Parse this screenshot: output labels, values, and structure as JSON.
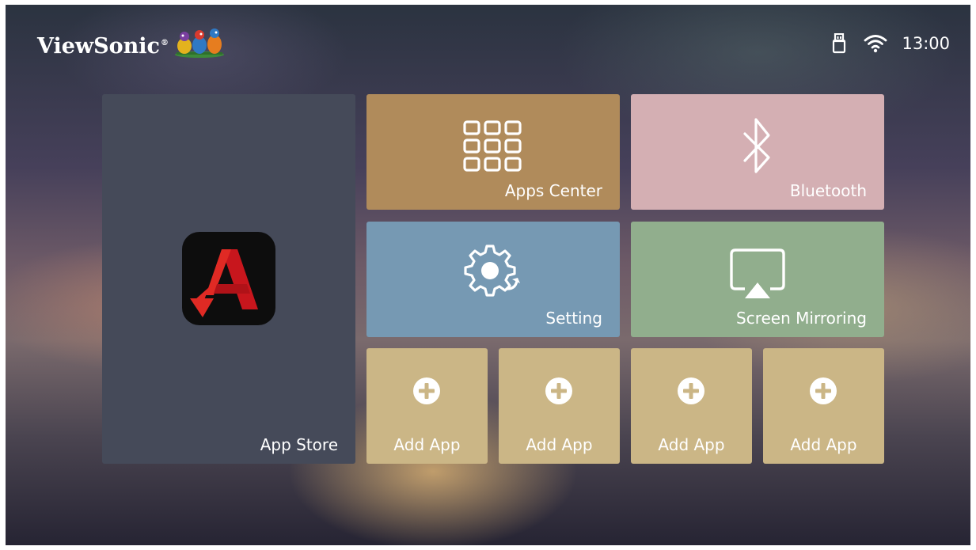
{
  "header": {
    "brand": "ViewSonic",
    "brand_mark": "®",
    "status": {
      "usb_icon": "usb-drive-icon",
      "wifi_icon": "wifi-icon",
      "time": "13:00"
    }
  },
  "tiles": {
    "app_store": {
      "label": "App Store",
      "icon": "aptoide-icon",
      "color": "#454a59"
    },
    "apps_center": {
      "label": "Apps Center",
      "icon": "grid-icon",
      "color": "#b08b5b"
    },
    "bluetooth": {
      "label": "Bluetooth",
      "icon": "bluetooth-icon",
      "color": "#d4afb3"
    },
    "setting": {
      "label": "Setting",
      "icon": "gear-icon",
      "color": "#7699b3"
    },
    "screen_mirroring": {
      "label": "Screen Mirroring",
      "icon": "airplay-icon",
      "color": "#91ae8d"
    },
    "add_apps": [
      {
        "label": "Add App",
        "icon": "plus-circle-icon"
      },
      {
        "label": "Add App",
        "icon": "plus-circle-icon"
      },
      {
        "label": "Add App",
        "icon": "plus-circle-icon"
      },
      {
        "label": "Add App",
        "icon": "plus-circle-icon"
      }
    ],
    "add_color": "#cbb686"
  }
}
